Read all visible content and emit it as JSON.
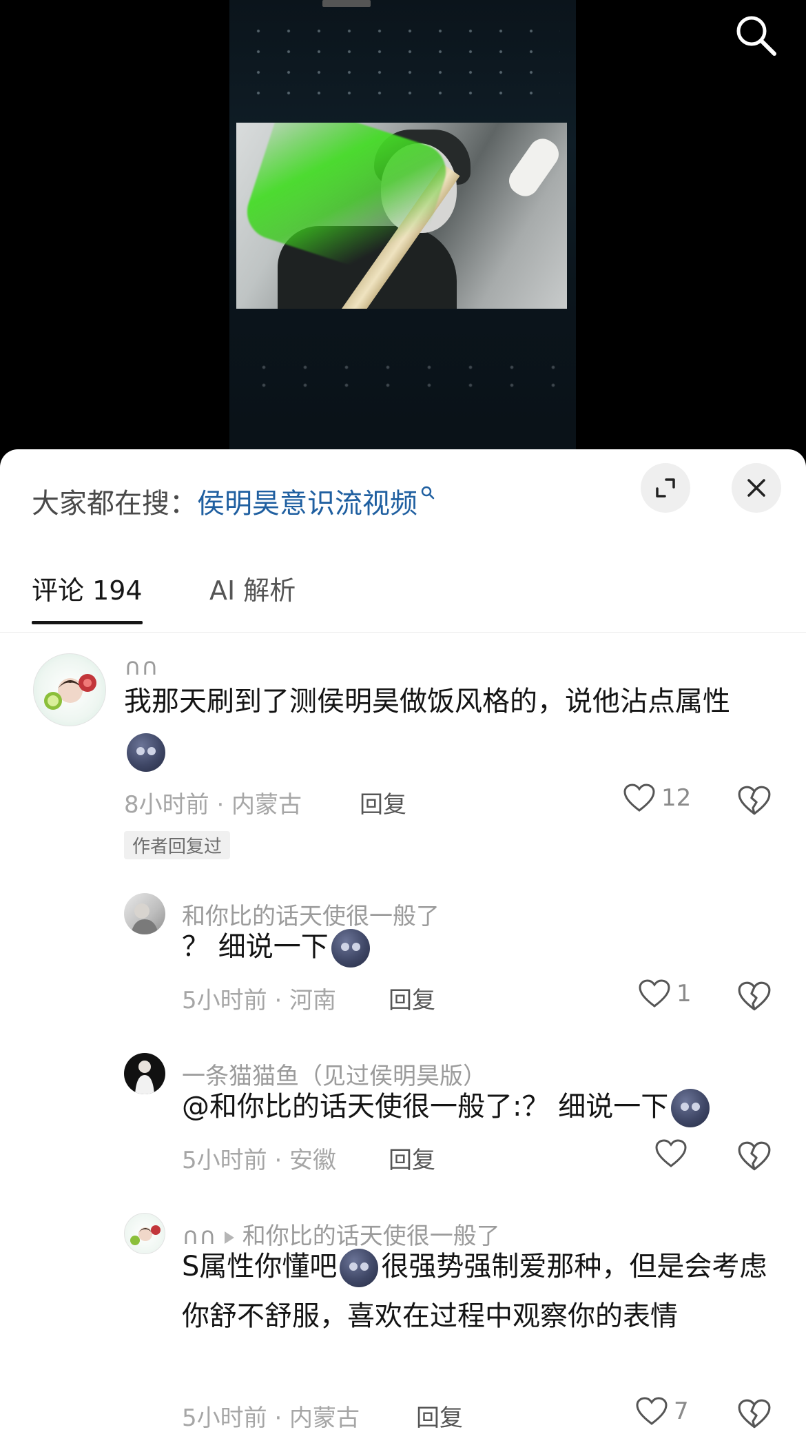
{
  "search_bar": {
    "prefix": "大家都在搜：",
    "query": "侯明昊意识流视频"
  },
  "tabs": [
    {
      "label": "评论 194",
      "active": true
    },
    {
      "label": "AI 解析",
      "active": false
    }
  ],
  "comments": [
    {
      "username": "∩∩",
      "text": "我那天刷到了测侯明昊做饭风格的，说他沾点属性",
      "emoji_after": "new-moon-face",
      "time": "8小时前 · 内蒙古",
      "reply_label": "回复",
      "likes": "12",
      "badge": "作者回复过"
    },
    {
      "username": "和你比的话天使很一般了",
      "text": "？ 细说一下",
      "emoji_after": "new-moon-face",
      "time": "5小时前 · 河南",
      "reply_label": "回复",
      "likes": "1"
    },
    {
      "username": "一条猫猫鱼（见过侯明昊版）",
      "text": "@和你比的话天使很一般了:？ 细说一下",
      "emoji_after": "new-moon-face",
      "time": "5小时前 · 安徽",
      "reply_label": "回复",
      "likes": ""
    },
    {
      "username": "∩∩",
      "reply_to": "和你比的话天使很一般了",
      "text_part1": "S属性你懂吧",
      "text_part2": "很强势强制爱那种，但是会考虑你舒不舒服，喜欢在过程中观察你的表情",
      "time": "5小时前 · 内蒙古",
      "reply_label": "回复",
      "likes": "7"
    }
  ],
  "icons": [
    "search-icon",
    "expand-icon",
    "close-icon",
    "heart-icon",
    "broken-heart-icon",
    "new-moon-face-emoji"
  ],
  "colors": {
    "link": "#1f5fa0",
    "meta": "#a6a6a6",
    "text": "#141414"
  }
}
